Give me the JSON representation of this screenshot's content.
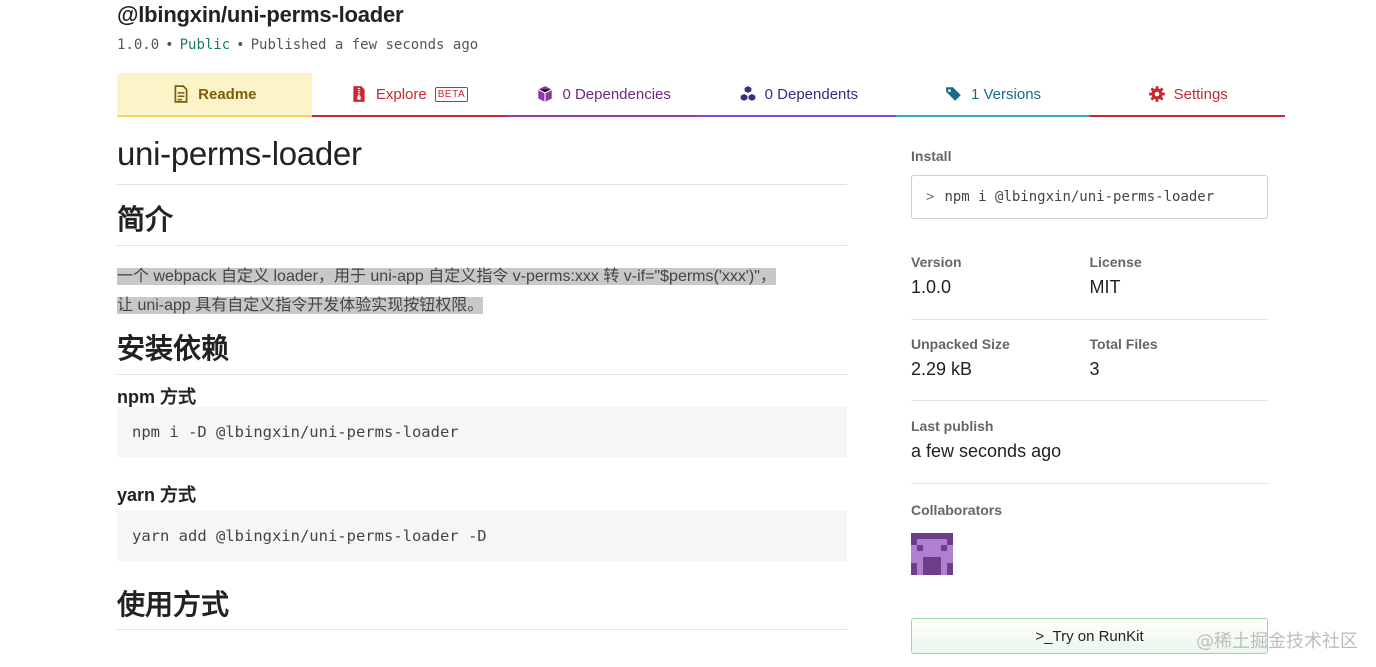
{
  "package": {
    "name": "@lbingxin/uni-perms-loader",
    "version": "1.0.0",
    "visibility": "Public",
    "published": "Published a few seconds ago",
    "separator": "•"
  },
  "tabs": [
    {
      "label": "Readme",
      "icon": "file-icon",
      "color": "#7a5f0b"
    },
    {
      "label": "Explore",
      "badge": "BETA",
      "icon": "zip-file-icon",
      "color": "#c62a33"
    },
    {
      "label": "0 Dependencies",
      "icon": "cube-icon",
      "color": "#6b2a7b"
    },
    {
      "label": "0 Dependents",
      "icon": "cubes-icon",
      "color": "#3f2a7b"
    },
    {
      "label": "1 Versions",
      "icon": "tags-icon",
      "color": "#176a8a"
    },
    {
      "label": "Settings",
      "icon": "gear-icon",
      "color": "#c62a33"
    }
  ],
  "readme": {
    "title": "uni-perms-loader",
    "intro_heading": "简介",
    "intro_line1": "一个 webpack 自定义 loader，用于 uni-app 自定义指令 v-perms:xxx 转 v-if=\"$perms('xxx')\"，",
    "intro_line2": "让 uni-app 具有自定义指令开发体验实现按钮权限。",
    "install_heading": "安装依赖",
    "npm_heading": "npm 方式",
    "npm_cmd": "npm i -D @lbingxin/uni-perms-loader",
    "yarn_heading": "yarn 方式",
    "yarn_cmd": "yarn add @lbingxin/uni-perms-loader -D",
    "usage_heading": "使用方式"
  },
  "sidebar": {
    "install_label": "Install",
    "install_prompt": ">",
    "install_cmd": "npm i @lbingxin/uni-perms-loader",
    "version_label": "Version",
    "version_value": "1.0.0",
    "license_label": "License",
    "license_value": "MIT",
    "unpacked_label": "Unpacked Size",
    "unpacked_value": "2.29 kB",
    "files_label": "Total Files",
    "files_value": "3",
    "last_publish_label": "Last publish",
    "last_publish_value": "a few seconds ago",
    "collaborators_label": "Collaborators",
    "runkit_label": ">_Try on RunKit"
  },
  "watermark": "@稀土掘金技术社区"
}
